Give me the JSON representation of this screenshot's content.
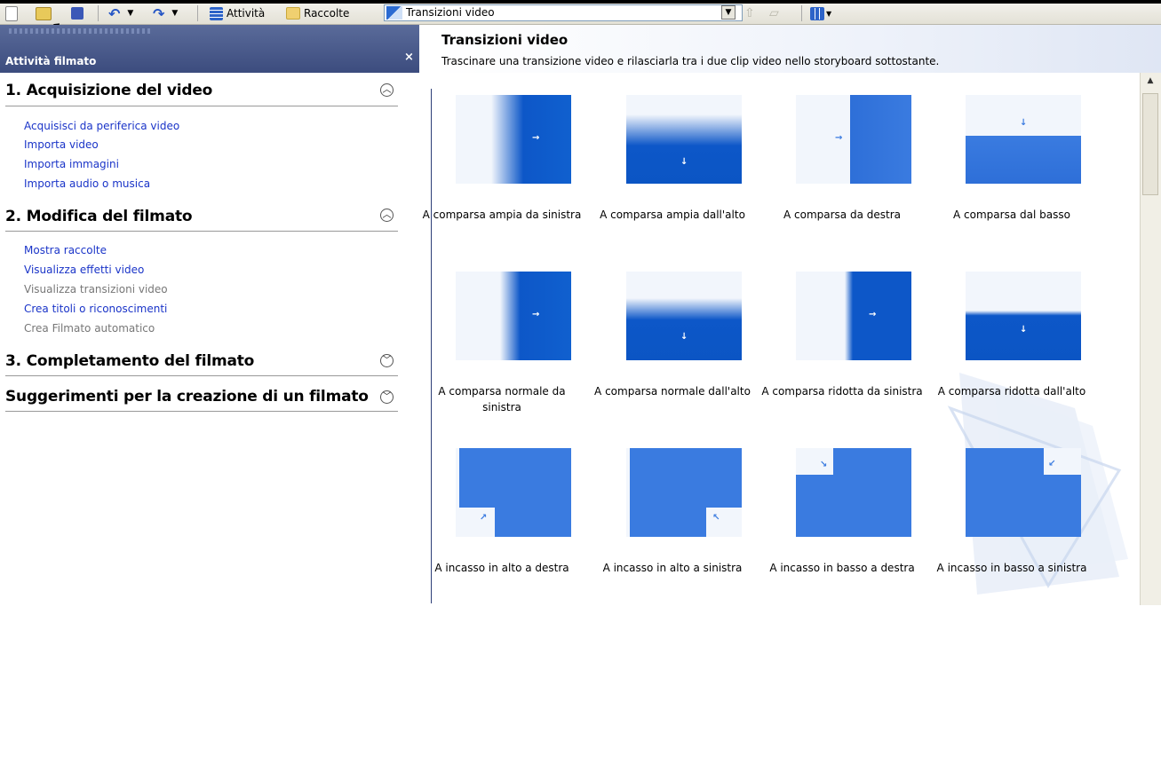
{
  "toolbar": {
    "tasks_label": "Attività",
    "collections_label": "Raccolte",
    "location_value": "Transizioni video"
  },
  "task_pane": {
    "title": "Attività filmato",
    "close_symbol": "×",
    "sections": [
      {
        "title": "1. Acquisizione del video",
        "state": "expanded",
        "items": [
          {
            "label": "Acquisisci da periferica video",
            "enabled": true
          },
          {
            "label": "Importa video",
            "enabled": true
          },
          {
            "label": "Importa immagini",
            "enabled": true
          },
          {
            "label": "Importa audio o musica",
            "enabled": true
          }
        ]
      },
      {
        "title": "2. Modifica del filmato",
        "state": "expanded",
        "items": [
          {
            "label": "Mostra raccolte",
            "enabled": true
          },
          {
            "label": "Visualizza effetti video",
            "enabled": true
          },
          {
            "label": "Visualizza transizioni video",
            "enabled": false
          },
          {
            "label": "Crea titoli o riconoscimenti",
            "enabled": true
          },
          {
            "label": "Crea Filmato automatico",
            "enabled": false
          }
        ]
      },
      {
        "title": "3. Completamento del filmato",
        "state": "collapsed",
        "items": []
      },
      {
        "title": "Suggerimenti per la creazione di un filmato",
        "state": "collapsed",
        "items": []
      }
    ]
  },
  "content": {
    "title": "Transizioni video",
    "subtitle": "Trascinare una transizione video e rilasciarla tra i due clip video nello storyboard sottostante.",
    "transitions": [
      {
        "label": "A comparsa ampia da sinistra",
        "kind": "wipe-left-wide"
      },
      {
        "label": "A comparsa ampia dall'alto",
        "kind": "wipe-top-wide"
      },
      {
        "label": "A comparsa da destra",
        "kind": "wipe-right"
      },
      {
        "label": "A comparsa dal basso",
        "kind": "wipe-bottom"
      },
      {
        "label": "A comparsa normale da sinistra",
        "kind": "wipe-left-normal"
      },
      {
        "label": "A comparsa normale dall'alto",
        "kind": "wipe-top-normal"
      },
      {
        "label": "A comparsa ridotta da sinistra",
        "kind": "wipe-left-narrow"
      },
      {
        "label": "A comparsa ridotta dall'alto",
        "kind": "wipe-top-narrow"
      },
      {
        "label": "A incasso in alto a destra",
        "kind": "inset-top-right"
      },
      {
        "label": "A incasso in alto a sinistra",
        "kind": "inset-top-left"
      },
      {
        "label": "A incasso in basso a destra",
        "kind": "inset-bottom-right"
      },
      {
        "label": "A incasso in basso a sinistra",
        "kind": "inset-bottom-left"
      }
    ]
  }
}
